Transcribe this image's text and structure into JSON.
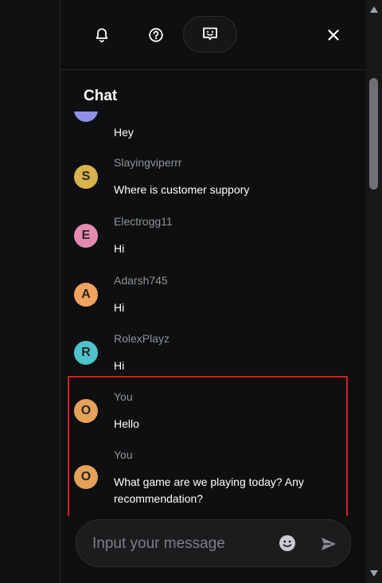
{
  "toolbar": {
    "icons": [
      "bell-icon",
      "help-circle-icon",
      "chat-message-icon",
      "close-icon"
    ],
    "active": "chat-message-icon"
  },
  "chat": {
    "title": "Chat",
    "messages": [
      {
        "username": "",
        "initial": "",
        "text": "Hey",
        "avatar_color": "#8f8fe8"
      },
      {
        "username": "Slayingviperrr",
        "initial": "S",
        "text": "Where is customer suppory",
        "avatar_color": "#d9b24c"
      },
      {
        "username": "Electrogg11",
        "initial": "E",
        "text": "Hi",
        "avatar_color": "#e58bb0"
      },
      {
        "username": "Adarsh745",
        "initial": "A",
        "text": "Hi",
        "avatar_color": "#f0a35e"
      },
      {
        "username": "RolexPlayz",
        "initial": "R",
        "text": "Hi",
        "avatar_color": "#4fc3cc"
      },
      {
        "username": "You",
        "initial": "O",
        "text": "Hello",
        "avatar_color": "#e6a259"
      },
      {
        "username": "You",
        "initial": "O",
        "text": "What game are we playing today? Any recommendation?",
        "avatar_color": "#e6a259"
      }
    ]
  },
  "input": {
    "placeholder": "Input your message",
    "value": ""
  },
  "colors": {
    "background": "#0e0f10",
    "highlight": "#d71e28"
  }
}
